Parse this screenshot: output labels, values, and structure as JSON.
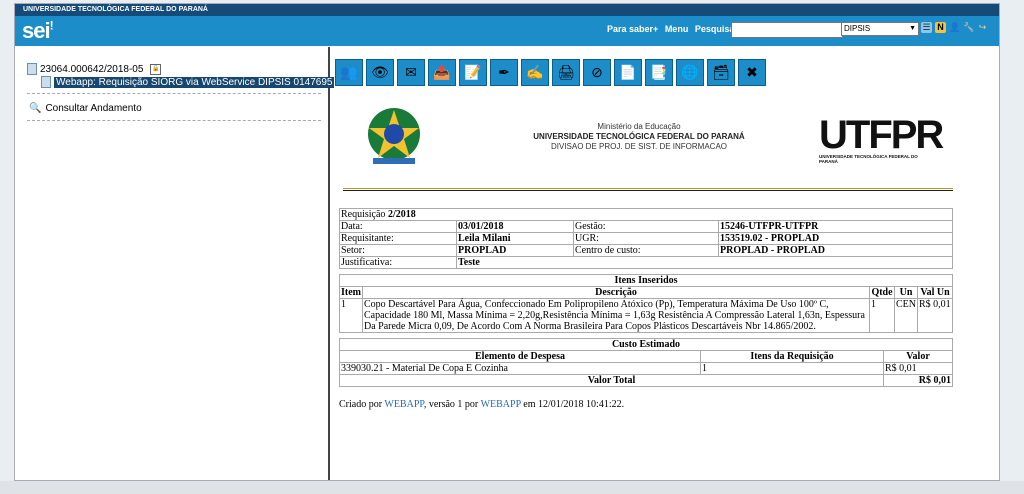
{
  "app": {
    "university_banner": "UNIVERSIDADE TECNOLÓGICA FEDERAL DO PARANÁ",
    "logo": "sei",
    "links": [
      "Para saber+",
      "Menu",
      "Pesquisa"
    ],
    "search": {
      "value": ""
    },
    "unit_select": "DIPSIS",
    "header_icons": [
      "list-icon",
      "news-icon",
      "user-icon",
      "settings-icon",
      "exit-icon"
    ]
  },
  "sidebar": {
    "process_number": "23064.000642/2018-05",
    "document_label": "Webapp: Requisição SIORG via WebService DIPSIS 0147695",
    "consult_label": "Consultar Andamento"
  },
  "toolbar": {
    "buttons": [
      {
        "icon": "people-icon",
        "glyph": "👥"
      },
      {
        "icon": "eye-icon",
        "glyph": "👁"
      },
      {
        "icon": "mail-icon",
        "glyph": "✉"
      },
      {
        "icon": "send-icon",
        "glyph": "📤"
      },
      {
        "icon": "edit-icon",
        "glyph": "📝"
      },
      {
        "icon": "pen-icon",
        "glyph": "✒"
      },
      {
        "icon": "sign-icon",
        "glyph": "✍"
      },
      {
        "icon": "print-icon",
        "glyph": "🖨"
      },
      {
        "icon": "cancel-icon",
        "glyph": "⊘"
      },
      {
        "icon": "note-icon",
        "glyph": "📄"
      },
      {
        "icon": "copy-icon",
        "glyph": "📑"
      },
      {
        "icon": "web-icon",
        "glyph": "🌐"
      },
      {
        "icon": "archive-icon",
        "glyph": "🗃"
      },
      {
        "icon": "delete-icon",
        "glyph": "✖"
      }
    ]
  },
  "letterhead": {
    "ministry": "Ministério da Educação",
    "university": "UNIVERSIDADE TECNOLÓGICA FEDERAL DO PARANÁ",
    "division": "DIVISAO DE PROJ. DE SIST. DE INFORMACAO",
    "logo_text": "UTFPR",
    "logo_caption": "UNIVERSIDADE TECNOLÓGICA FEDERAL DO PARANÁ"
  },
  "requisition": {
    "title_prefix": "Requisição ",
    "title_number": "2/2018",
    "data_label": "Data:",
    "data_value": "03/01/2018",
    "gestao_label": "Gestão:",
    "gestao_value": "15246-UTFPR-UTFPR",
    "requisitante_label": "Requisitante:",
    "requisitante_value": "Leila Milani",
    "ugr_label": "UGR:",
    "ugr_value": "153519.02 - PROPLAD",
    "setor_label": "Setor:",
    "setor_value": "PROPLAD",
    "centro_label": "Centro de custo:",
    "centro_value": "PROPLAD - PROPLAD",
    "justificativa_label": "Justificativa:",
    "justificativa_value": "Teste"
  },
  "items": {
    "title": "Itens Inseridos",
    "headers": [
      "Item",
      "Descrição",
      "Qtde",
      "Un",
      "Val Un"
    ],
    "rows": [
      {
        "item": "1",
        "descricao": "Copo Descartável Para Água, Confeccionado Em Polipropileno Atóxico (Pp), Temperatura Máxima De Uso 100º C, Capacidade 180 Ml, Massa Mínima = 2,20g,Resistência Mínima = 1,63g Resistência A Compressão Lateral 1,63n, Espessura Da Parede Micra 0,09, De Acordo Com A Norma Brasileira Para Copos Plásticos Descartáveis Nbr 14.865/2002.",
        "qtde": "1",
        "un": "CEN",
        "val_un": "R$ 0,01"
      }
    ]
  },
  "cost": {
    "title": "Custo Estimado",
    "headers": [
      "Elemento de Despesa",
      "Itens da Requisição",
      "Valor"
    ],
    "rows": [
      {
        "elemento": "339030.21 - Material De Copa E Cozinha",
        "itens": "1",
        "valor": "R$ 0,01"
      }
    ],
    "total_label": "Valor Total",
    "total_value": "R$ 0,01"
  },
  "footer": {
    "prefix": "Criado por ",
    "creator": "WEBAPP",
    "middle": ", versão 1 por ",
    "editor": "WEBAPP",
    "suffix": " em 12/01/2018 10:41:22."
  }
}
